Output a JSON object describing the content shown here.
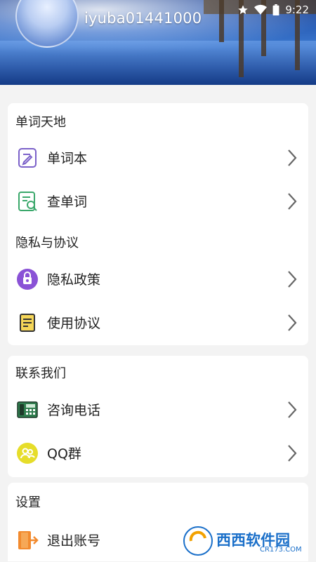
{
  "header": {
    "username": "iyuba01441000"
  },
  "status_bar": {
    "time": "9:22",
    "icons": [
      "star-icon",
      "wifi-icon",
      "battery-icon"
    ]
  },
  "sections": {
    "words": {
      "title": "单词天地",
      "items": [
        {
          "label": "单词本",
          "icon": "notebook-icon"
        },
        {
          "label": "查单词",
          "icon": "search-document-icon"
        }
      ]
    },
    "privacy": {
      "title": "隐私与协议",
      "items": [
        {
          "label": "隐私政策",
          "icon": "privacy-lock-icon"
        },
        {
          "label": "使用协议",
          "icon": "agreement-document-icon"
        }
      ]
    },
    "contact": {
      "title": "联系我们",
      "items": [
        {
          "label": "咨询电话",
          "icon": "phone-icon"
        },
        {
          "label": "QQ群",
          "icon": "group-icon"
        }
      ]
    },
    "settings": {
      "title": "设置",
      "items": [
        {
          "label": "退出账号",
          "icon": "logout-icon"
        }
      ]
    }
  },
  "watermark": {
    "text": "西西软件园",
    "sub": "CR173.COM"
  },
  "colors": {
    "accent_purple": "#7b61c9",
    "accent_green": "#3aa86b",
    "accent_orange": "#f28a2e",
    "accent_yellow": "#e6dd2a"
  }
}
